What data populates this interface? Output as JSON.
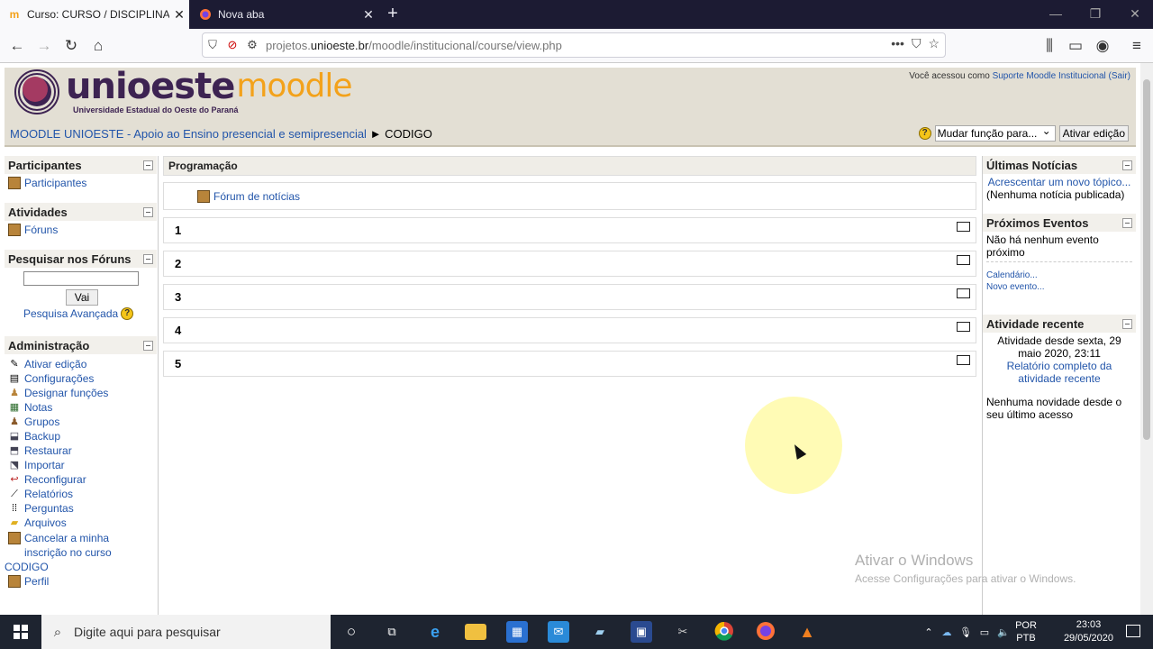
{
  "browser": {
    "tabs": [
      {
        "title": "Curso: CURSO / DISCIPLINA - E",
        "active": true
      },
      {
        "title": "Nova aba",
        "active": false
      }
    ],
    "url_prefix": "projetos.",
    "url_domain": "unioeste.br",
    "url_path": "/moodle/institucional/course/view.php"
  },
  "header": {
    "logo_word": "unioeste",
    "logo_moodle": "moodle",
    "logo_sub": "Universidade Estadual do Oeste do Paraná",
    "logged_in_prefix": "Você acessou como",
    "logged_in_user": "Suporte Moodle Institucional",
    "logout_label": "(Sair)"
  },
  "breadcrumb": {
    "root": "MOODLE UNIOESTE - Apoio ao Ensino presencial e semipresencial",
    "separator": "►",
    "current": "CODIGO"
  },
  "role": {
    "select_value": "Mudar função para...",
    "edit_button": "Ativar edição"
  },
  "left": {
    "participants": {
      "title": "Participantes",
      "items": [
        "Participantes"
      ]
    },
    "activities": {
      "title": "Atividades",
      "items": [
        "Fóruns"
      ]
    },
    "search": {
      "title": "Pesquisar nos Fóruns",
      "go": "Vai",
      "advanced": "Pesquisa Avançada"
    },
    "admin": {
      "title": "Administração",
      "items": [
        {
          "label": "Ativar edição",
          "icon": "pencil-icon"
        },
        {
          "label": "Configurações",
          "icon": "settings-icon"
        },
        {
          "label": "Designar funções",
          "icon": "roles-icon"
        },
        {
          "label": "Notas",
          "icon": "grades-icon"
        },
        {
          "label": "Grupos",
          "icon": "groups-icon"
        },
        {
          "label": "Backup",
          "icon": "backup-icon"
        },
        {
          "label": "Restaurar",
          "icon": "restore-icon"
        },
        {
          "label": "Importar",
          "icon": "import-icon"
        },
        {
          "label": "Reconfigurar",
          "icon": "reset-icon"
        },
        {
          "label": "Relatórios",
          "icon": "reports-icon"
        },
        {
          "label": "Perguntas",
          "icon": "questions-icon"
        },
        {
          "label": "Arquivos",
          "icon": "folder-icon"
        }
      ],
      "unenrol_line1": "Cancelar a minha",
      "unenrol_line2": "inscrição no curso",
      "unenrol_line3": "CODIGO",
      "profile": "Perfil"
    }
  },
  "center": {
    "section_title": "Programação",
    "forum_link": "Fórum de notícias",
    "weeks": [
      "1",
      "2",
      "3",
      "4",
      "5"
    ]
  },
  "right": {
    "news": {
      "title": "Últimas Notícias",
      "add_link": "Acrescentar um novo tópico...",
      "empty": "(Nenhuma notícia publicada)"
    },
    "events": {
      "title": "Próximos Eventos",
      "empty": "Não há nenhum evento próximo",
      "calendar": "Calendário...",
      "new_event": "Novo evento..."
    },
    "recent": {
      "title": "Atividade recente",
      "since": "Atividade desde sexta, 29 maio 2020, 23:11",
      "full_report": "Relatório completo da atividade recente",
      "none": "Nenhuma novidade desde o seu último acesso"
    }
  },
  "watermark": {
    "line1": "Ativar o Windows",
    "line2": "Acesse Configurações para ativar o Windows."
  },
  "taskbar": {
    "search_placeholder": "Digite aqui para pesquisar",
    "lang_line1": "POR",
    "lang_line2": "PTB",
    "time": "23:03",
    "date": "29/05/2020"
  },
  "colors": {
    "link": "#2255aa",
    "header_bg": "#e3dfd4",
    "accent_orange": "#f3a21b",
    "brand_purple": "#3d2352"
  }
}
